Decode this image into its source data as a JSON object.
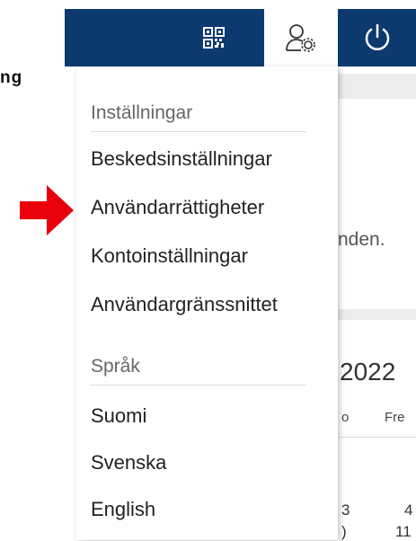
{
  "background_page": {
    "cut_label": "ng",
    "text_fragment": "nden.",
    "year_fragment": "2022",
    "day_fragment_1": "o",
    "day_fragment_2": "Fre",
    "row1_a": "3",
    "row1_b": "4",
    "row2_a": ")",
    "row2_b": "11"
  },
  "toolbar": {
    "qr_icon": "qr-code-icon",
    "user_icon": "user-settings-icon",
    "power_icon": "power-icon",
    "bar_color": "#0d3a6e"
  },
  "menu": {
    "settings_header": "Inställningar",
    "settings_items": [
      {
        "label": "Beskedsinställningar"
      },
      {
        "label": "Användarrättigheter"
      },
      {
        "label": "Kontoinställningar"
      },
      {
        "label": "Användargränssnittet"
      }
    ],
    "language_header": "Språk",
    "language_items": [
      {
        "label": "Suomi"
      },
      {
        "label": "Svenska"
      },
      {
        "label": "English"
      }
    ]
  },
  "annotation": {
    "arrow_color": "#e8000b"
  }
}
